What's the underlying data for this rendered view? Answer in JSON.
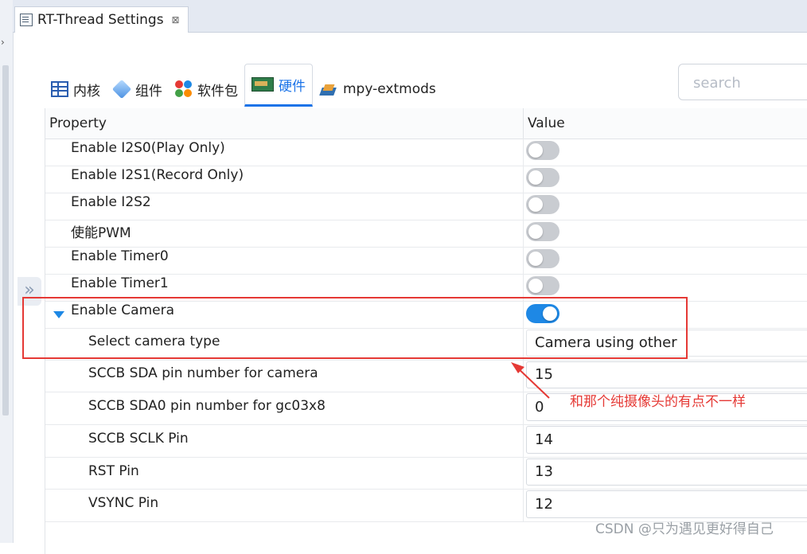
{
  "editor_tab": {
    "title": "RT-Thread Settings",
    "close": "⊠"
  },
  "tabs": [
    {
      "label": "内核",
      "icon": "kernel-table-icon"
    },
    {
      "label": "组件",
      "icon": "component-cube-icon"
    },
    {
      "label": "软件包",
      "icon": "packages-icon"
    },
    {
      "label": "硬件",
      "icon": "hardware-board-icon",
      "active": true
    },
    {
      "label": "mpy-extmods",
      "icon": "mpy-extmods-icon"
    }
  ],
  "search": {
    "placeholder": "search",
    "value": ""
  },
  "expand_handle": "»",
  "table": {
    "headers": {
      "property": "Property",
      "value": "Value"
    },
    "rows": [
      {
        "label": "Enable I2S0(Play Only)",
        "type": "toggle",
        "on": false
      },
      {
        "label": "Enable I2S1(Record Only)",
        "type": "toggle",
        "on": false
      },
      {
        "label": "Enable I2S2",
        "type": "toggle",
        "on": false
      },
      {
        "label": "使能PWM",
        "type": "toggle",
        "on": false
      },
      {
        "label": "Enable Timer0",
        "type": "toggle",
        "on": false
      },
      {
        "label": "Enable Timer1",
        "type": "toggle",
        "on": false
      },
      {
        "label": "Enable Camera",
        "type": "toggle",
        "on": true,
        "expanded": true
      },
      {
        "label": "Select camera type",
        "type": "text",
        "value": "Camera using other"
      },
      {
        "label": "SCCB SDA pin number for camera",
        "type": "text",
        "value": "15"
      },
      {
        "label": "SCCB SDA0 pin number for gc03x8",
        "type": "text",
        "value": "0"
      },
      {
        "label": "SCCB SCLK Pin",
        "type": "text",
        "value": "14"
      },
      {
        "label": "RST Pin",
        "type": "text",
        "value": "13"
      },
      {
        "label": "VSYNC Pin",
        "type": "text",
        "value": "12"
      }
    ]
  },
  "annotation": {
    "note": "和那个纯摄像头的有点不一样",
    "color": "#e53935"
  },
  "watermark": "CSDN @只为遇见更好得自己",
  "colors": {
    "accent": "#1a73e8",
    "toggle_on": "#1e88e5",
    "toggle_off": "#c9ccd1"
  }
}
